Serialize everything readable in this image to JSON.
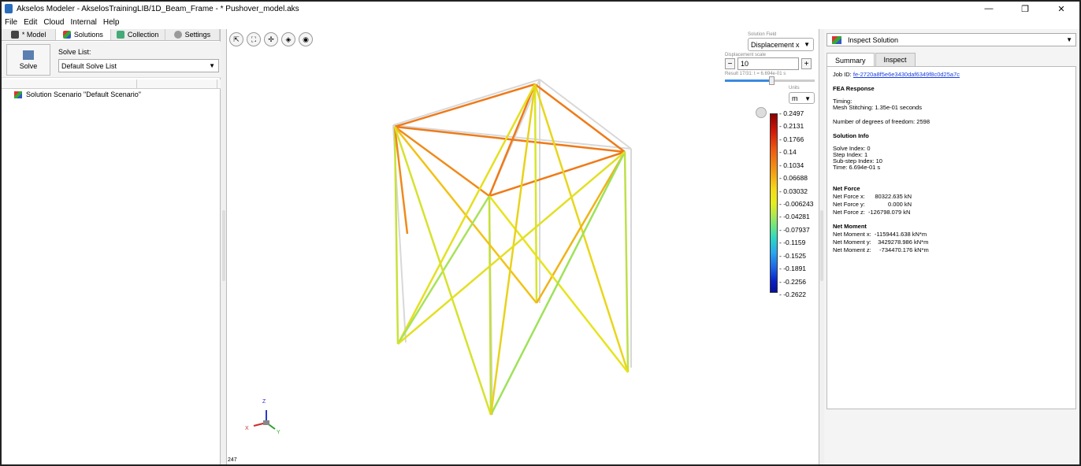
{
  "window": {
    "title": "Akselos Modeler - AkselosTrainingLIB/1D_Beam_Frame - * Pushover_model.aks",
    "minimize": "—",
    "restore": "❐",
    "close": "✕"
  },
  "menu": [
    "File",
    "Edit",
    "Cloud",
    "Internal",
    "Help"
  ],
  "left_tabs": [
    {
      "label": "* Model",
      "color": "#444"
    },
    {
      "label": "Solutions",
      "color": "#2a8"
    },
    {
      "label": "Collection",
      "color": "#4a7"
    },
    {
      "label": "Settings",
      "color": "#888"
    }
  ],
  "solve": {
    "button": "Solve",
    "list_label": "Solve List:",
    "list_value": "Default Solve List"
  },
  "tree": {
    "item": "Solution Scenario \"Default Scenario\""
  },
  "viewport": {
    "solution_field_label": "Solution Field",
    "solution_field": "Displacement x",
    "disp_scale_label": "Displacement scale",
    "disp_scale": "10",
    "result_label": "Result 17/31: t = 6.694e-01 s",
    "result_fraction": 0.52,
    "units_label": "Units",
    "units": "m",
    "colorbar": [
      "0.2497",
      "0.2131",
      "0.1766",
      "0.14",
      "0.1034",
      "0.06688",
      "0.03032",
      "-0.006243",
      "-0.04281",
      "-0.07937",
      "-0.1159",
      "-0.1525",
      "-0.1891",
      "-0.2256",
      "-0.2622"
    ],
    "axis": {
      "z": "Z",
      "x": "X",
      "y": "Y"
    },
    "coord": "247"
  },
  "inspect": {
    "dropdown": "Inspect Solution",
    "tabs": [
      "Summary",
      "Inspect"
    ],
    "job_id_label": "Job ID:",
    "job_id": "fe-2720a8f5e6e3430daf6349f8c0d25a7c",
    "fea_title": "FEA Response",
    "timing": "Timing:",
    "mesh": "Mesh Stitching: 1.35e-01 seconds",
    "dof": "Number of degrees of freedom: 2598",
    "sol_title": "Solution Info",
    "solve_index": "Solve Index: 0",
    "step_index": "Step Index: 1",
    "substep": "Sub-step Index: 10",
    "time": "Time: 6.694e-01 s",
    "net_force_title": "Net Force",
    "fx": "Net Force x:      80322.635 kN",
    "fy": "Net Force y:              0.000 kN",
    "fz": "Net Force z:  -126798.079 kN",
    "net_moment_title": "Net Moment",
    "mx": "Net Moment x:  -1159441.638 kN*m",
    "my": "Net Moment y:    3429278.986 kN*m",
    "mz": "Net Moment z:     -734470.176 kN*m"
  }
}
